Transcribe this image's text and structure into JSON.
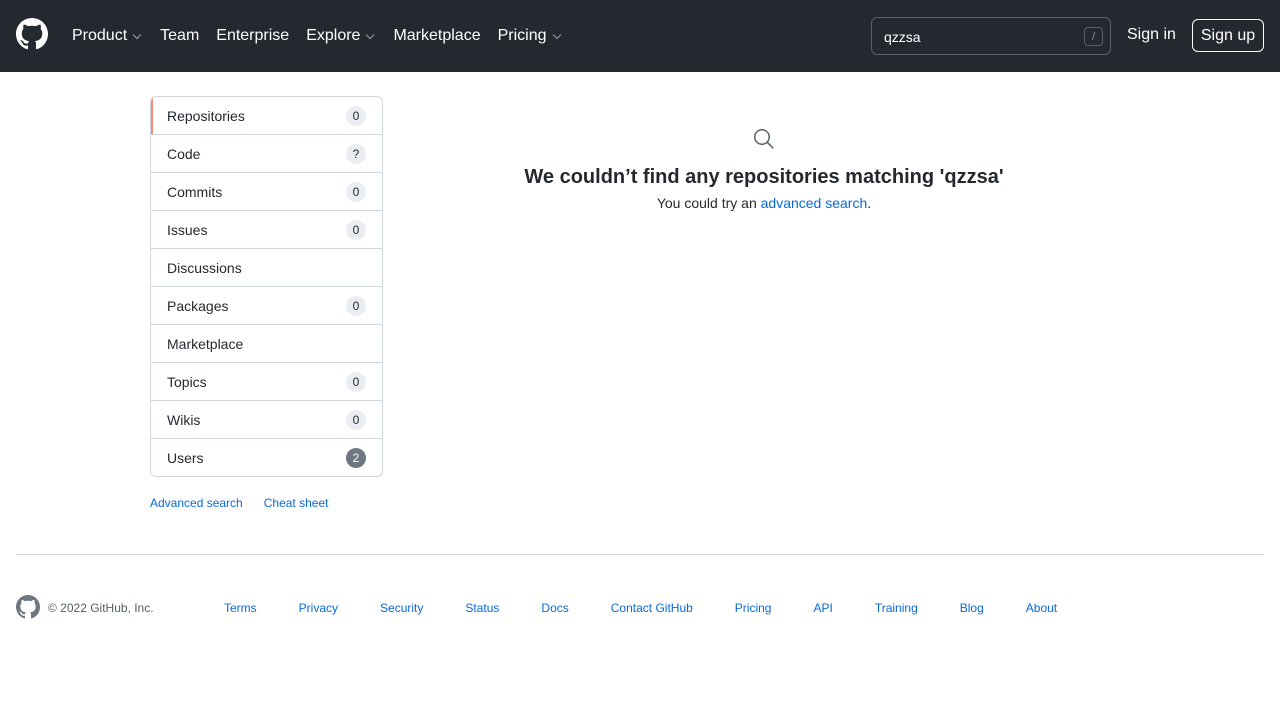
{
  "header": {
    "nav": [
      {
        "label": "Product",
        "has_dropdown": true
      },
      {
        "label": "Team",
        "has_dropdown": false
      },
      {
        "label": "Enterprise",
        "has_dropdown": false
      },
      {
        "label": "Explore",
        "has_dropdown": true
      },
      {
        "label": "Marketplace",
        "has_dropdown": false
      },
      {
        "label": "Pricing",
        "has_dropdown": true
      }
    ],
    "search": {
      "value": "qzzsa",
      "shortcut": "/"
    },
    "signin_label": "Sign in",
    "signup_label": "Sign up",
    "icons": {
      "logo": "github-mark-icon",
      "dropdown": "chevron-down-icon"
    }
  },
  "sidebar": {
    "items": [
      {
        "label": "Repositories",
        "count": "0",
        "selected": true
      },
      {
        "label": "Code",
        "count": "?"
      },
      {
        "label": "Commits",
        "count": "0"
      },
      {
        "label": "Issues",
        "count": "0"
      },
      {
        "label": "Discussions",
        "count": null
      },
      {
        "label": "Packages",
        "count": "0"
      },
      {
        "label": "Marketplace",
        "count": null
      },
      {
        "label": "Topics",
        "count": "0"
      },
      {
        "label": "Wikis",
        "count": "0"
      },
      {
        "label": "Users",
        "count": "2",
        "emphasis": true
      }
    ],
    "links": [
      "Advanced search",
      "Cheat sheet"
    ]
  },
  "main": {
    "icon": "search-icon",
    "title": "We couldn’t find any repositories matching 'qzzsa'",
    "subtitle_prefix": "You could try an ",
    "subtitle_link": "advanced search",
    "subtitle_suffix": "."
  },
  "footer": {
    "copyright": "© 2022 GitHub, Inc.",
    "links": [
      "Terms",
      "Privacy",
      "Security",
      "Status",
      "Docs",
      "Contact GitHub",
      "Pricing",
      "API",
      "Training",
      "Blog",
      "About"
    ],
    "icon": "github-mark-icon"
  },
  "colors": {
    "header_bg": "#24292f",
    "link": "#0969da",
    "selected_accent": "#fd8c73",
    "border": "#d0d7de"
  }
}
